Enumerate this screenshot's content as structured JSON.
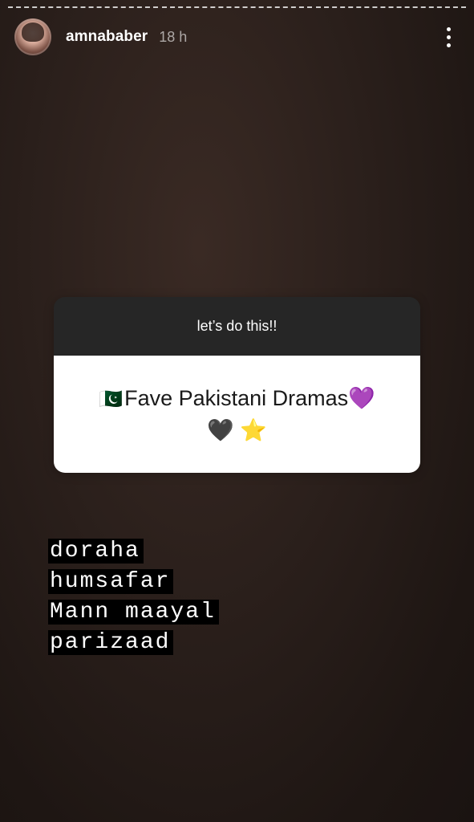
{
  "story": {
    "progress_segments": 3
  },
  "header": {
    "username": "amnababer",
    "timestamp": "18 h",
    "more_icon": "more-vertical-icon"
  },
  "question_card": {
    "prompt": "let’s do this!!",
    "question_flag": "🇵🇰",
    "question_text": "Fave Pakistani Dramas",
    "question_emoji_1": "💜",
    "question_emoji_2": "🖤",
    "question_emoji_3": "⭐"
  },
  "answers": [
    "doraha",
    "humsafar",
    "Mann maayal",
    "parizaad"
  ]
}
